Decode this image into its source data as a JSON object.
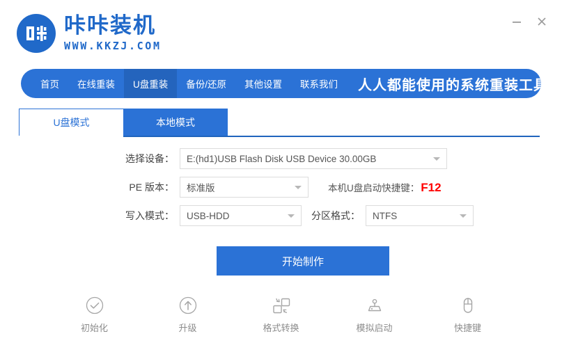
{
  "window": {
    "minimize_label": "—",
    "close_label": "×",
    "minimize_icon": "minimize-icon",
    "close_icon": "close-icon"
  },
  "brand": {
    "logo_glyph": "咔",
    "title": "咔咔装机",
    "subtitle": "WWW.KKZJ.COM"
  },
  "nav": {
    "items": [
      {
        "label": "首页",
        "active": false
      },
      {
        "label": "在线重装",
        "active": false
      },
      {
        "label": "U盘重装",
        "active": true
      },
      {
        "label": "备份/还原",
        "active": false
      },
      {
        "label": "其他设置",
        "active": false
      },
      {
        "label": "联系我们",
        "active": false
      }
    ],
    "slogan": "人人都能使用的系统重装工具",
    "bg_color": "#2b72d6",
    "active_bg_color": "#2464bd"
  },
  "tabs": [
    {
      "label": "U盘模式",
      "active": true
    },
    {
      "label": "本地模式",
      "active": false
    }
  ],
  "form": {
    "device": {
      "label": "选择设备：",
      "value": "E:(hd1)USB Flash Disk USB Device 30.00GB"
    },
    "pe_version": {
      "label": "PE 版本：",
      "value": "标准版"
    },
    "hotkey": {
      "label": "本机U盘启动快捷键：",
      "key": "F12",
      "key_color": "#ff0000"
    },
    "write_mode": {
      "label": "写入模式：",
      "value": "USB-HDD"
    },
    "partition_format": {
      "label": "分区格式：",
      "value": "NTFS"
    }
  },
  "actions": {
    "start_label": "开始制作"
  },
  "tools": [
    {
      "label": "初始化",
      "icon": "check-circle-icon"
    },
    {
      "label": "升级",
      "icon": "arrow-up-circle-icon"
    },
    {
      "label": "格式转换",
      "icon": "format-convert-icon"
    },
    {
      "label": "模拟启动",
      "icon": "joystick-icon"
    },
    {
      "label": "快捷键",
      "icon": "mouse-icon"
    }
  ]
}
